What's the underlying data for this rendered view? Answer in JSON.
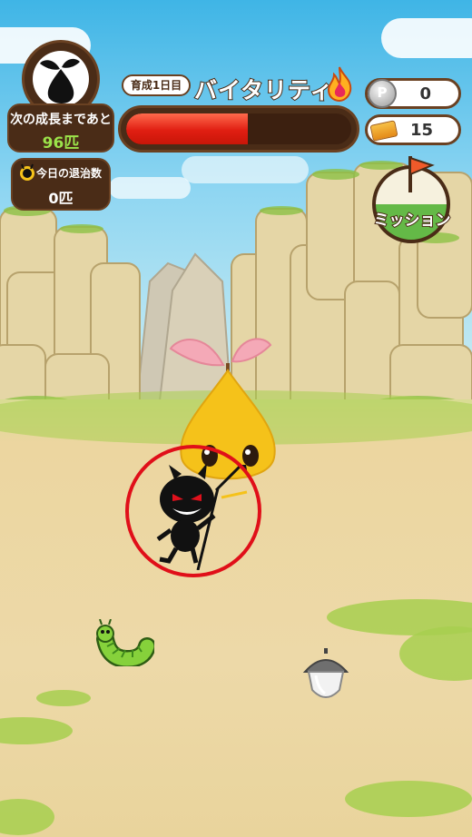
{
  "hud": {
    "growth": {
      "label": "次の成長まであと",
      "value": "96匹"
    },
    "defeat": {
      "label": "今日の退治数",
      "value": "0匹"
    },
    "day_tag": "育成1日目",
    "vitality": {
      "title": "バイタリティ",
      "level": 0.54
    },
    "coins": {
      "icon_letter": "P",
      "value": "0"
    },
    "tickets": {
      "value": "15"
    },
    "mission": {
      "label": "ミッション"
    }
  },
  "characters": {
    "sprout": "sprout-mascot",
    "devil": "devil-bug-enemy",
    "caterpillar": "green-caterpillar",
    "acorn": "acorn-item"
  },
  "colors": {
    "panel": "#4a2c17",
    "panel_border": "#6a4122",
    "growth_value": "#9be34a",
    "vitality_fill": "#e01e12",
    "target_ring": "#e00f19"
  }
}
